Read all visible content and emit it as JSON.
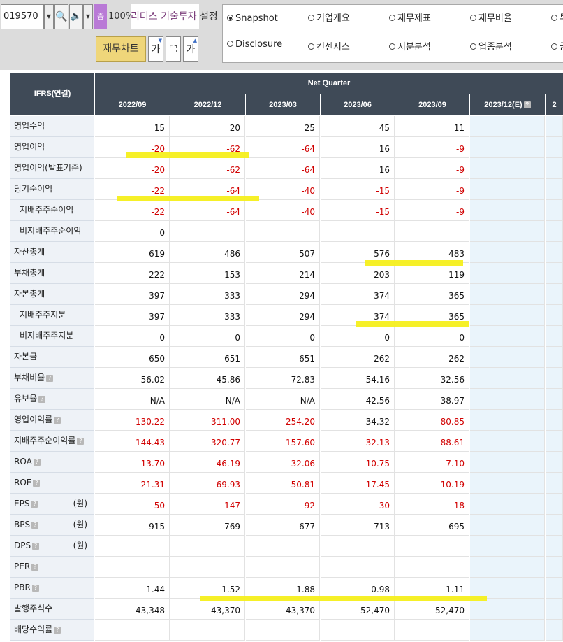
{
  "toolbar": {
    "code": "019570",
    "dropdown_arrow": "▼",
    "search_icon": "🔍",
    "speaker_icon": "🔈",
    "badge": "증",
    "zoom": "100%",
    "ticker": "리더스 기술투자",
    "settings": "설정",
    "chart_button": "재무차트",
    "tool1": "가",
    "tool2": "⛶",
    "tool3": "가"
  },
  "menu": {
    "row1": [
      "Snapshot",
      "기업개요",
      "재무제표",
      "재무비율",
      "투"
    ],
    "row2": [
      "Disclosure",
      "컨센서스",
      "지분분석",
      "업종분석",
      "금"
    ],
    "selected": "Snapshot"
  },
  "table": {
    "label_header": "IFRS(연결)",
    "group_header": "Net Quarter",
    "periods": [
      "2022/09",
      "2022/12",
      "2023/03",
      "2023/06",
      "2023/09",
      "2023/12(E)",
      "2"
    ],
    "rows": [
      {
        "label": "영업수익",
        "indent": false,
        "help": false,
        "unit": "",
        "values": [
          "15",
          "20",
          "25",
          "45",
          "11"
        ]
      },
      {
        "label": "영업이익",
        "indent": false,
        "help": false,
        "unit": "",
        "values": [
          "-20",
          "-62",
          "-64",
          "16",
          "-9"
        ]
      },
      {
        "label": "영업이익(발표기준)",
        "indent": false,
        "help": false,
        "unit": "",
        "values": [
          "-20",
          "-62",
          "-64",
          "16",
          "-9"
        ]
      },
      {
        "label": "당기순이익",
        "indent": false,
        "help": false,
        "unit": "",
        "values": [
          "-22",
          "-64",
          "-40",
          "-15",
          "-9"
        ]
      },
      {
        "label": "지배주주순이익",
        "indent": true,
        "help": false,
        "unit": "",
        "values": [
          "-22",
          "-64",
          "-40",
          "-15",
          "-9"
        ]
      },
      {
        "label": "비지배주주순이익",
        "indent": true,
        "help": false,
        "unit": "",
        "values": [
          "0",
          "",
          "",
          "",
          ""
        ]
      },
      {
        "label": "자산총계",
        "indent": false,
        "help": false,
        "unit": "",
        "values": [
          "619",
          "486",
          "507",
          "576",
          "483"
        ]
      },
      {
        "label": "부채총계",
        "indent": false,
        "help": false,
        "unit": "",
        "values": [
          "222",
          "153",
          "214",
          "203",
          "119"
        ]
      },
      {
        "label": "자본총계",
        "indent": false,
        "help": false,
        "unit": "",
        "values": [
          "397",
          "333",
          "294",
          "374",
          "365"
        ]
      },
      {
        "label": "지배주주지분",
        "indent": true,
        "help": false,
        "unit": "",
        "values": [
          "397",
          "333",
          "294",
          "374",
          "365"
        ]
      },
      {
        "label": "비지배주주지분",
        "indent": true,
        "help": false,
        "unit": "",
        "values": [
          "0",
          "0",
          "0",
          "0",
          "0"
        ]
      },
      {
        "label": "자본금",
        "indent": false,
        "help": false,
        "unit": "",
        "values": [
          "650",
          "651",
          "651",
          "262",
          "262"
        ]
      },
      {
        "label": "부채비율",
        "indent": false,
        "help": true,
        "unit": "",
        "values": [
          "56.02",
          "45.86",
          "72.83",
          "54.16",
          "32.56"
        ]
      },
      {
        "label": "유보율",
        "indent": false,
        "help": true,
        "unit": "",
        "values": [
          "N/A",
          "N/A",
          "N/A",
          "42.56",
          "38.97"
        ]
      },
      {
        "label": "영업이익률",
        "indent": false,
        "help": true,
        "unit": "",
        "values": [
          "-130.22",
          "-311.00",
          "-254.20",
          "34.32",
          "-80.85"
        ]
      },
      {
        "label": "지배주주순이익률",
        "indent": false,
        "help": true,
        "unit": "",
        "values": [
          "-144.43",
          "-320.77",
          "-157.60",
          "-32.13",
          "-88.61"
        ]
      },
      {
        "label": "ROA",
        "indent": false,
        "help": true,
        "unit": "",
        "values": [
          "-13.70",
          "-46.19",
          "-32.06",
          "-10.75",
          "-7.10"
        ]
      },
      {
        "label": "ROE",
        "indent": false,
        "help": true,
        "unit": "",
        "values": [
          "-21.31",
          "-69.93",
          "-50.81",
          "-17.45",
          "-10.19"
        ]
      },
      {
        "label": "EPS",
        "indent": false,
        "help": true,
        "unit": "(원)",
        "values": [
          "-50",
          "-147",
          "-92",
          "-30",
          "-18"
        ]
      },
      {
        "label": "BPS",
        "indent": false,
        "help": true,
        "unit": "(원)",
        "values": [
          "915",
          "769",
          "677",
          "713",
          "695"
        ]
      },
      {
        "label": "DPS",
        "indent": false,
        "help": true,
        "unit": "(원)",
        "values": [
          "",
          "",
          "",
          "",
          ""
        ]
      },
      {
        "label": "PER",
        "indent": false,
        "help": true,
        "unit": "",
        "values": [
          "",
          "",
          "",
          "",
          ""
        ]
      },
      {
        "label": "PBR",
        "indent": false,
        "help": true,
        "unit": "",
        "values": [
          "1.44",
          "1.52",
          "1.88",
          "0.98",
          "1.11"
        ]
      },
      {
        "label": "발행주식수",
        "indent": false,
        "help": false,
        "unit": "",
        "values": [
          "43,348",
          "43,370",
          "43,370",
          "52,470",
          "52,470"
        ]
      },
      {
        "label": "배당수익률",
        "indent": false,
        "help": true,
        "unit": "",
        "values": [
          "",
          "",
          "",
          "",
          ""
        ]
      }
    ]
  },
  "colors": {
    "header_bg": "#3f4a57",
    "label_bg": "#eef2f7",
    "negative": "#d10000",
    "estimate_bg": "#eaf4fb",
    "highlight": "#f5ef1c",
    "chart_button_bg": "#efd67a"
  }
}
